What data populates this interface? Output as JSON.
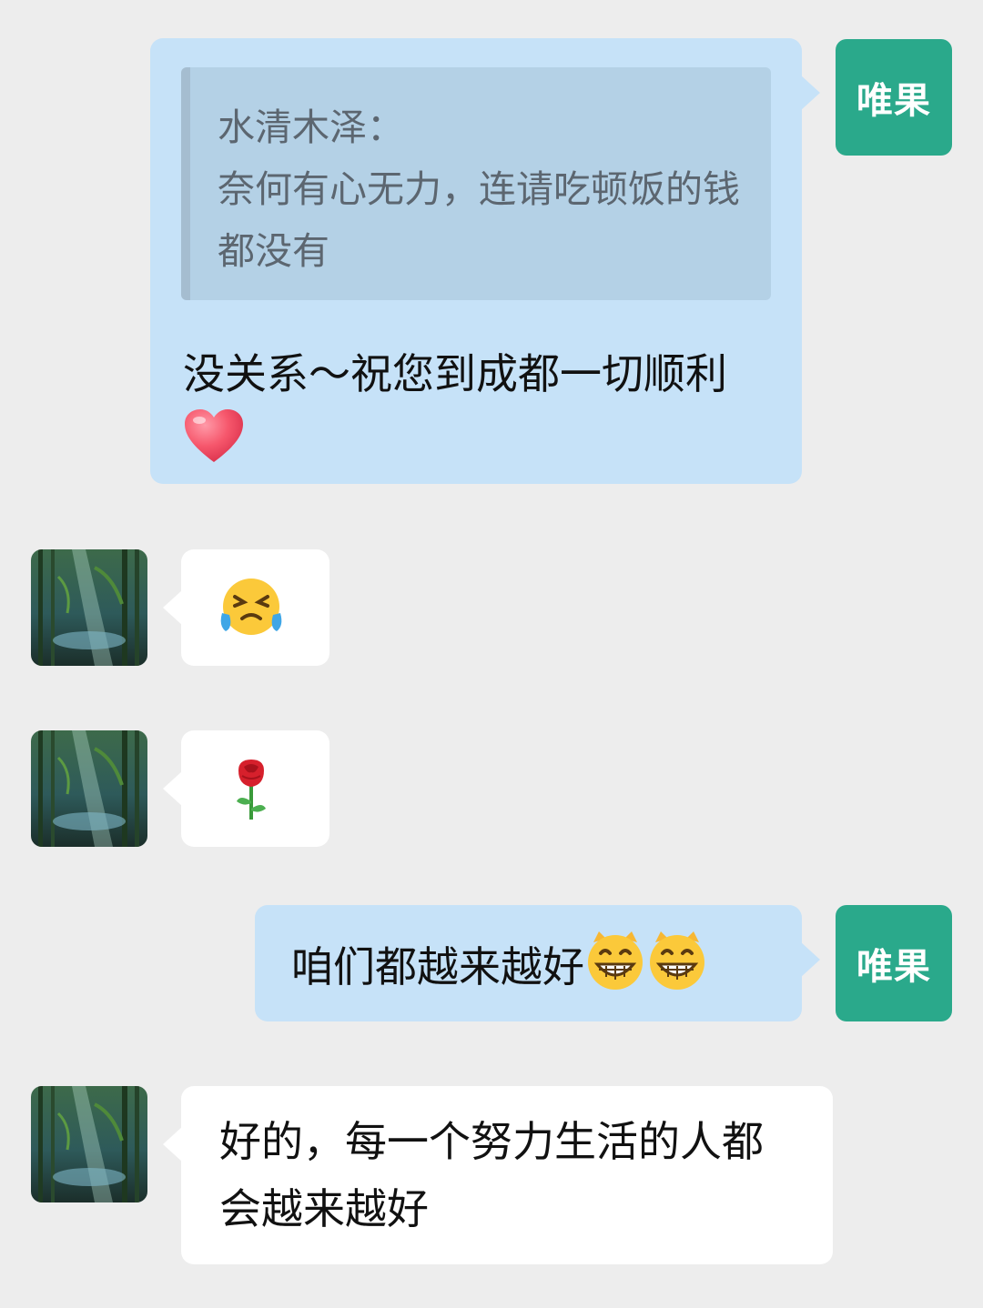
{
  "messages": [
    {
      "sender": "self",
      "avatar_label": "唯果",
      "quote": {
        "author": "水清木泽：",
        "text": "奈何有心无力，连请吃顿饭的钱都没有"
      },
      "text": "没关系～祝您到成都一切顺利",
      "emoji": "heart-icon"
    },
    {
      "sender": "other",
      "avatar": "bamboo-forest-avatar",
      "emoji": "crying-laughing-face-icon"
    },
    {
      "sender": "other",
      "avatar": "bamboo-forest-avatar",
      "emoji": "rose-icon"
    },
    {
      "sender": "self",
      "avatar_label": "唯果",
      "text": "咱们都越来越好",
      "emoji": "grinning-face-icon"
    },
    {
      "sender": "other",
      "avatar": "bamboo-forest-avatar",
      "text": "好的，每一个努力生活的人都会越来越好"
    }
  ],
  "colors": {
    "background": "#EDEDED",
    "self_bubble": "#C6E2F8",
    "other_bubble": "#FFFFFF",
    "self_avatar": "#2AA98B",
    "quote_bg": "#B4D1E6"
  }
}
